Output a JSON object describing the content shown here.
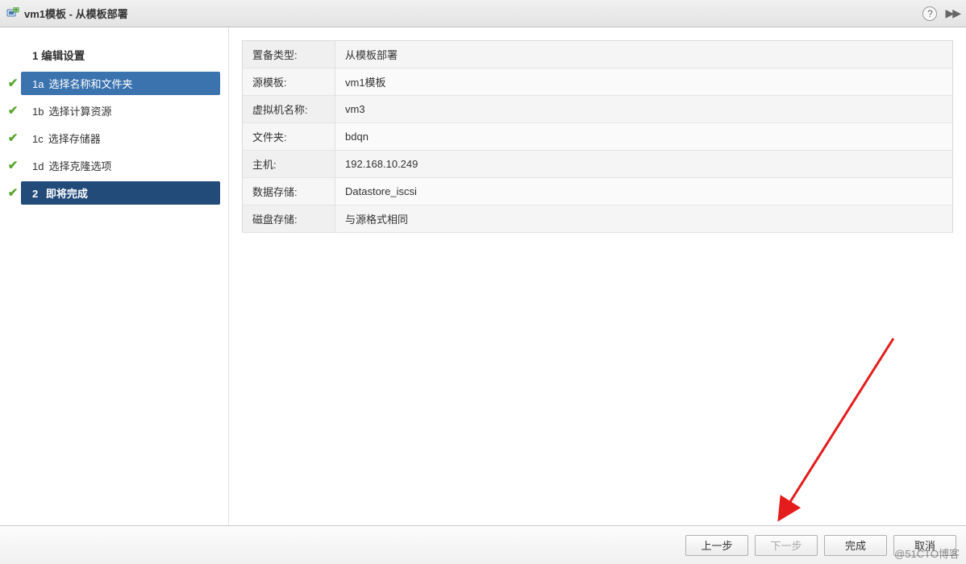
{
  "title": "vm1模板 - 从模板部署",
  "sidebar": {
    "sectionTitle": "1 编辑设置",
    "steps": [
      {
        "num": "1a",
        "label": "选择名称和文件夹",
        "checked": true,
        "state": "active"
      },
      {
        "num": "1b",
        "label": "选择计算资源",
        "checked": true,
        "state": ""
      },
      {
        "num": "1c",
        "label": "选择存储器",
        "checked": true,
        "state": ""
      },
      {
        "num": "1d",
        "label": "选择克隆选项",
        "checked": true,
        "state": ""
      }
    ],
    "final": {
      "num": "2",
      "label": "即将完成",
      "checked": true
    }
  },
  "summary": [
    {
      "key": "置备类型:",
      "val": "从模板部署"
    },
    {
      "key": "源模板:",
      "val": "vm1模板"
    },
    {
      "key": "虚拟机名称:",
      "val": "vm3"
    },
    {
      "key": "文件夹:",
      "val": "bdqn"
    },
    {
      "key": "主机:",
      "val": "192.168.10.249"
    },
    {
      "key": "数据存储:",
      "val": "Datastore_iscsi"
    },
    {
      "key": "磁盘存储:",
      "val": "与源格式相同"
    }
  ],
  "buttons": {
    "prev": "上一步",
    "next": "下一步",
    "finish": "完成",
    "cancel": "取消"
  },
  "watermark": "@51CTO博客"
}
